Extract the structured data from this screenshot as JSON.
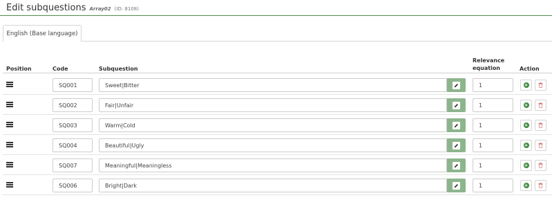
{
  "header": {
    "title": "Edit subquestions",
    "question_code": "Array02",
    "question_id": "(ID: 8108)"
  },
  "tabs": [
    {
      "label": "English (Base language)"
    }
  ],
  "table": {
    "columns": {
      "position": "Position",
      "code": "Code",
      "subquestion": "Subquestion",
      "relevance_line1": "Relevance",
      "relevance_line2": "equation",
      "action": "Action"
    },
    "rows": [
      {
        "code": "SQ001",
        "subquestion": "Sweet|Bitter",
        "relevance": "1"
      },
      {
        "code": "SQ002",
        "subquestion": "Fair|Unfair",
        "relevance": "1"
      },
      {
        "code": "SQ003",
        "subquestion": "Warm|Cold",
        "relevance": "1"
      },
      {
        "code": "SQ004",
        "subquestion": "Beautiful|Ugly",
        "relevance": "1"
      },
      {
        "code": "SQ007",
        "subquestion": "Meaningful|Meaningless",
        "relevance": "1"
      },
      {
        "code": "SQ006",
        "subquestion": "Bright|Dark",
        "relevance": "1"
      }
    ]
  },
  "icons": {
    "drag_handle": "bars-icon",
    "edit": "pencil-icon",
    "add": "plus-circle-icon",
    "delete": "trash-icon"
  },
  "colors": {
    "header_rule": "#4c8f4c",
    "edit_button": "#8db58d",
    "add_icon": "#3d8a3d",
    "delete_icon": "#d98080"
  }
}
